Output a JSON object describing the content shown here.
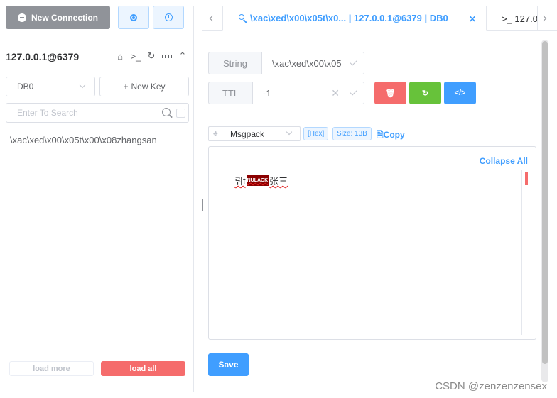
{
  "toolbar": {
    "new_connection": "New Connection"
  },
  "connection": {
    "title": "127.0.0.1@6379"
  },
  "db_select": {
    "value": "DB0"
  },
  "new_key": "New Key",
  "search": {
    "placeholder": "Enter To Search"
  },
  "keys": [
    "\\xac\\xed\\x00\\x05t\\x00\\x08zhangsan"
  ],
  "footer": {
    "load_more": "load more",
    "load_all": "load all"
  },
  "tabs": [
    {
      "label": "\\xac\\xed\\x00\\x05t\\x0... | 127.0.0.1@6379 | DB0",
      "active": true
    },
    {
      "label": ">_ 127.0",
      "active": false
    }
  ],
  "key_detail": {
    "type_label": "String",
    "key_value": "\\xac\\xed\\x00\\x05",
    "ttl_label": "TTL",
    "ttl_value": "-1"
  },
  "viewer": {
    "format": "Msgpack",
    "hex_tag": "[Hex]",
    "size_tag": "Size: 13B",
    "copy": "Copy",
    "collapse_all": "Collapse All",
    "content_prefix": "뤼t",
    "nul_label": "NULACK",
    "content_suffix": "张三"
  },
  "save": "Save",
  "watermark": "CSDN @zenzenzensex",
  "colors": {
    "primary": "#409eff",
    "danger": "#f56c6c",
    "success": "#67c23a",
    "info": "#909399"
  }
}
